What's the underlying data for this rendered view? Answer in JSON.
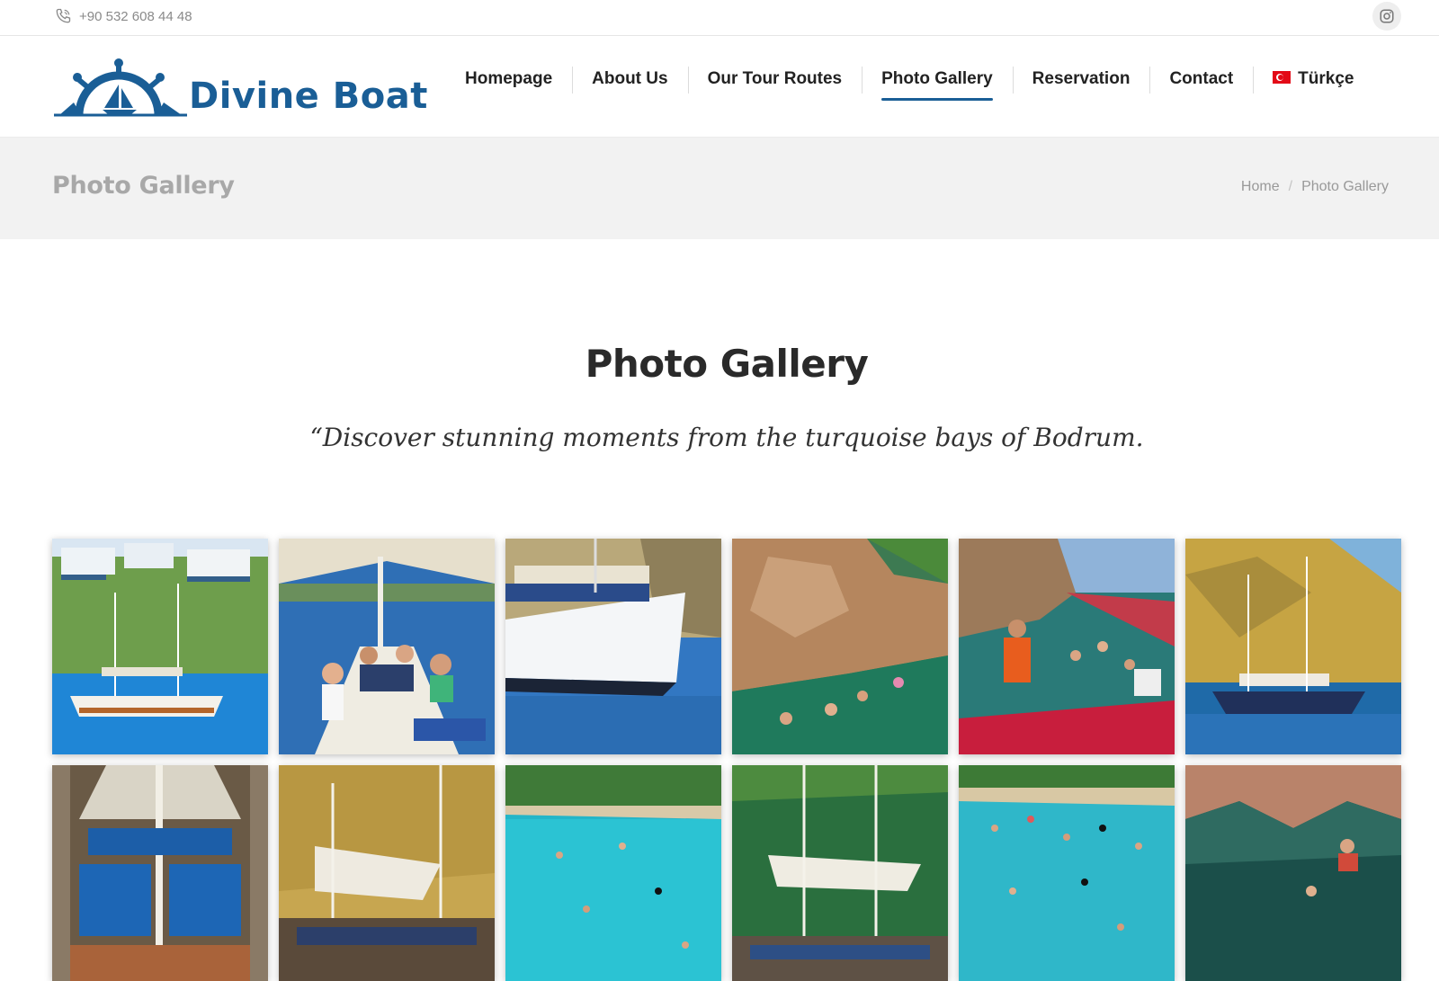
{
  "topbar": {
    "phone": "+90 532 608 44 48",
    "phone_icon": "phone-icon",
    "social_icon": "instagram-icon"
  },
  "brand": {
    "name": "Divine Boat",
    "logo_icon": "ship-wheel-icon",
    "color": "#1a5e96"
  },
  "nav": {
    "items": [
      "Homepage",
      "About Us",
      "Our Tour Routes",
      "Photo Gallery",
      "Reservation",
      "Contact",
      "Türkçe"
    ],
    "active_index": 3,
    "language_flag": "turkey-flag-icon"
  },
  "page_header": {
    "title": "Photo Gallery",
    "breadcrumb": [
      "Home",
      "Photo Gallery"
    ]
  },
  "main": {
    "title": "Photo Gallery",
    "subtitle": "“Discover stunning moments from the turquoise bays of Bodrum."
  },
  "gallery": {
    "photos": [
      "gulet-anchored-below-hillside-villas",
      "guests-waving-on-shaded-deck",
      "divine-boat-bow-in-cove",
      "swimmers-by-rocky-cliff",
      "guests-descending-ladder-into-sea",
      "gulet-below-dry-hillside",
      "gulet-deck-with-blue-cushions",
      "gulet-awning-on-dry-hillside",
      "turquoise-beach-with-swimmers",
      "gulet-in-green-bay",
      "crowded-beach-bay-swimmers",
      "cave-swimmers"
    ]
  }
}
